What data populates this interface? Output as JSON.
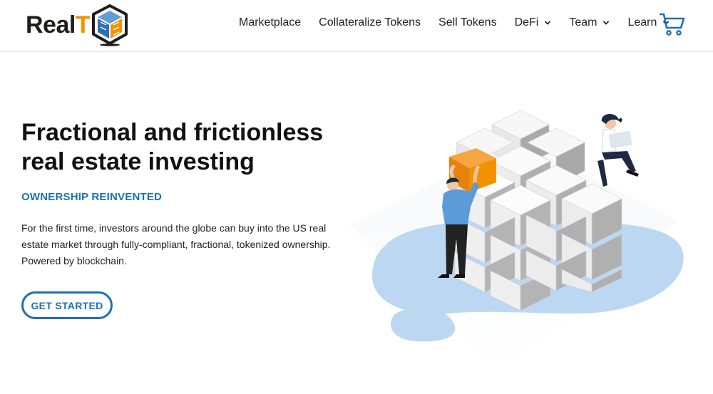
{
  "header": {
    "logo": {
      "text_main": "Real",
      "text_accent": "T",
      "mark": "realt-cube-logo"
    },
    "nav": [
      {
        "label": "Marketplace",
        "has_dropdown": false
      },
      {
        "label": "Collateralize Tokens",
        "has_dropdown": false
      },
      {
        "label": "Sell Tokens",
        "has_dropdown": false
      },
      {
        "label": "DeFi",
        "has_dropdown": true
      },
      {
        "label": "Team",
        "has_dropdown": true
      },
      {
        "label": "Learn",
        "has_dropdown": true
      }
    ],
    "cart_icon": "shopping-cart-icon"
  },
  "hero": {
    "title_line1": "Fractional and frictionless",
    "title_line2": "real estate investing",
    "tagline": "OWNERSHIP REINVENTED",
    "description": "For the first time, investors around the globe can buy into the US real estate market through fully-compliant, fractional, tokenized ownership. Powered by blockchain.",
    "cta_label": "GET STARTED",
    "illustration": "isometric-cube-blocks-with-people"
  },
  "colors": {
    "brand_blue": "#1e6fb5",
    "brand_orange": "#f39200",
    "blob_blue": "#bcd7f2",
    "text_dark": "#111111"
  }
}
